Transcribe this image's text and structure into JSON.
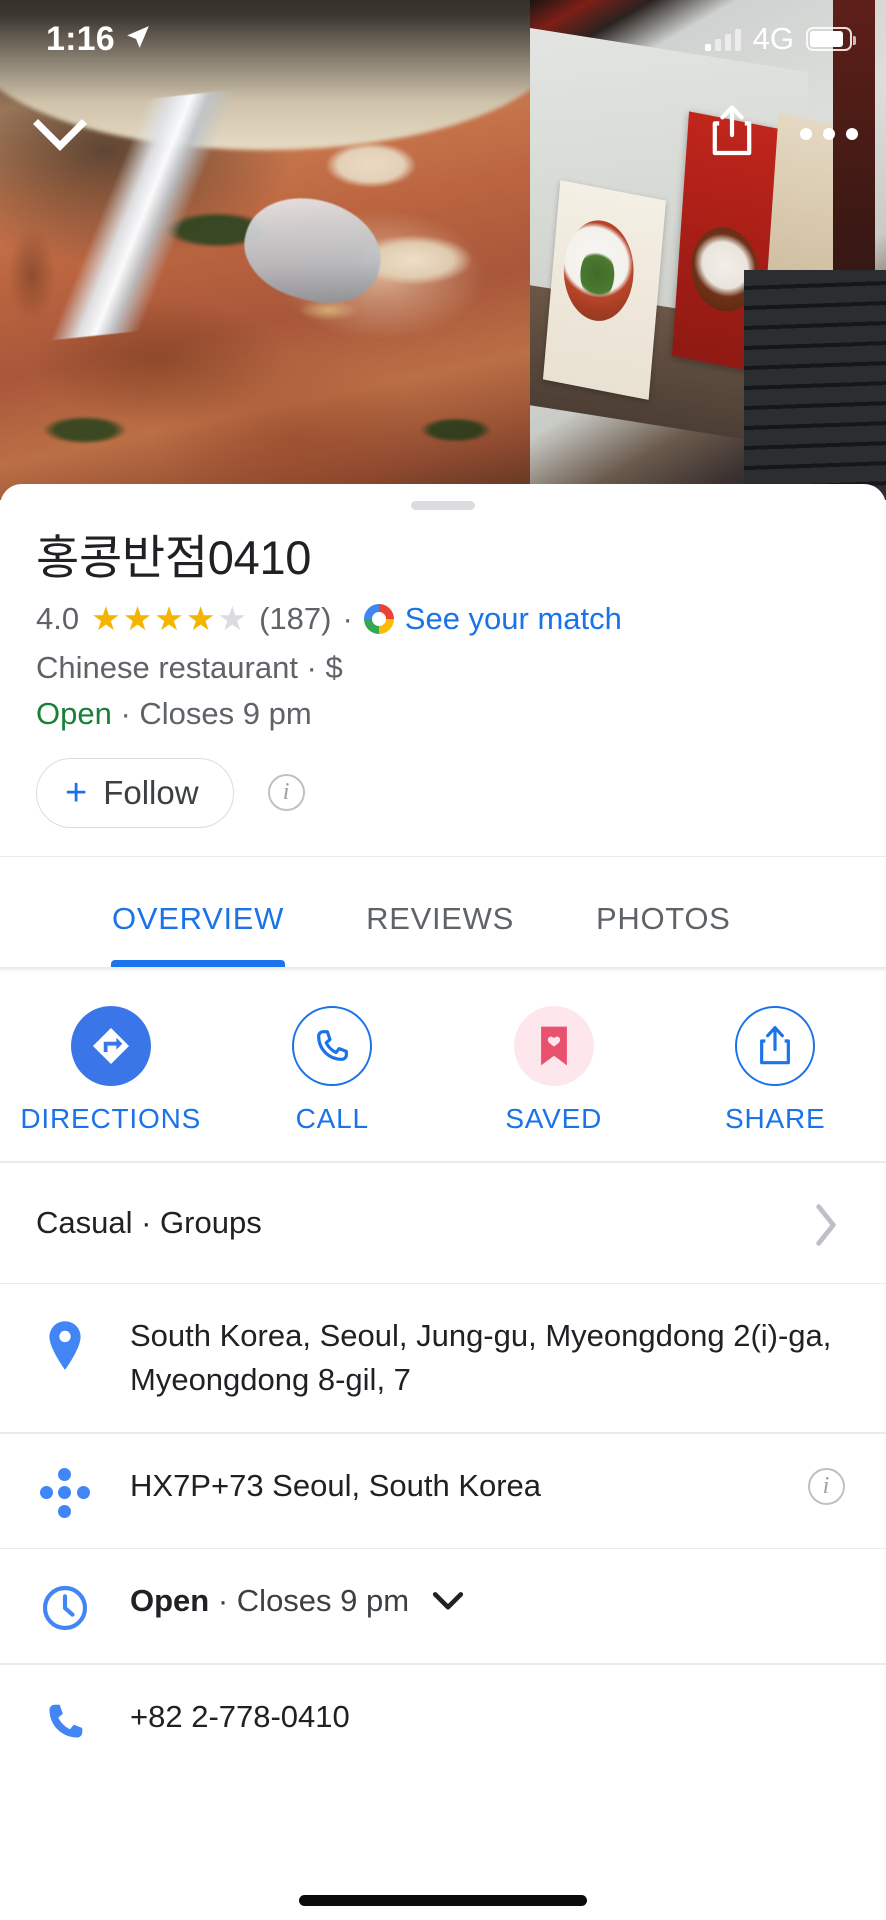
{
  "status_bar": {
    "time": "1:16",
    "location_icon": "location-arrow-icon",
    "network": "4G",
    "signal_icon": "signal-bars-icon",
    "battery_icon": "battery-icon"
  },
  "photo_header": {
    "collapse_icon": "chevron-down-icon",
    "share_icon": "share-icon",
    "more_icon": "more-options-icon",
    "main_photo_alt": "kimchi stew with rice on spoon",
    "secondary_photo_alt": "restaurant stairway with menu posters"
  },
  "place": {
    "title": "홍콩반점0410",
    "rating_value": "4.0",
    "stars_filled": 4,
    "stars_total": 5,
    "review_count": "(187)",
    "separator": "·",
    "match_link": "See your match",
    "match_icon": "google-circle-icon",
    "category": "Chinese restaurant",
    "price_level": "$",
    "category_line": "Chinese restaurant · $",
    "open_status": "Open",
    "closing_text": "· Closes 9 pm"
  },
  "follow": {
    "plus": "+",
    "label": "Follow",
    "info_icon": "info-icon",
    "info_glyph": "i"
  },
  "tabs": [
    {
      "label": "OVERVIEW",
      "active": true
    },
    {
      "label": "REVIEWS",
      "active": false
    },
    {
      "label": "PHOTOS",
      "active": false
    }
  ],
  "actions": [
    {
      "label": "DIRECTIONS",
      "icon": "directions-icon",
      "style": "filled"
    },
    {
      "label": "CALL",
      "icon": "phone-icon",
      "style": "outline"
    },
    {
      "label": "SAVED",
      "icon": "bookmark-heart-icon",
      "style": "pink"
    },
    {
      "label": "SHARE",
      "icon": "share-icon",
      "style": "outline"
    }
  ],
  "info_rows": {
    "attributes": {
      "text": "Casual · Groups",
      "chevron_icon": "chevron-right-icon"
    },
    "address": {
      "icon": "map-pin-icon",
      "text": "South Korea, Seoul, Jung-gu, Myeongdong 2(i)-ga, Myeongdong 8-gil, 7"
    },
    "plus_code": {
      "icon": "plus-code-icon",
      "text": "HX7P+73 Seoul, South Korea",
      "info_icon": "info-icon",
      "info_glyph": "i"
    },
    "hours": {
      "icon": "clock-icon",
      "status": "Open",
      "detail": "· Closes 9 pm",
      "chevron_icon": "chevron-down-icon"
    },
    "phone": {
      "icon": "phone-icon",
      "text": "+82 2-778-0410"
    }
  },
  "colors": {
    "accent_blue": "#1a73e8",
    "open_green": "#188038",
    "star_gold": "#f4b400",
    "saved_pink": "#e8526f",
    "text_primary": "#202124",
    "text_secondary": "#5f6368"
  }
}
